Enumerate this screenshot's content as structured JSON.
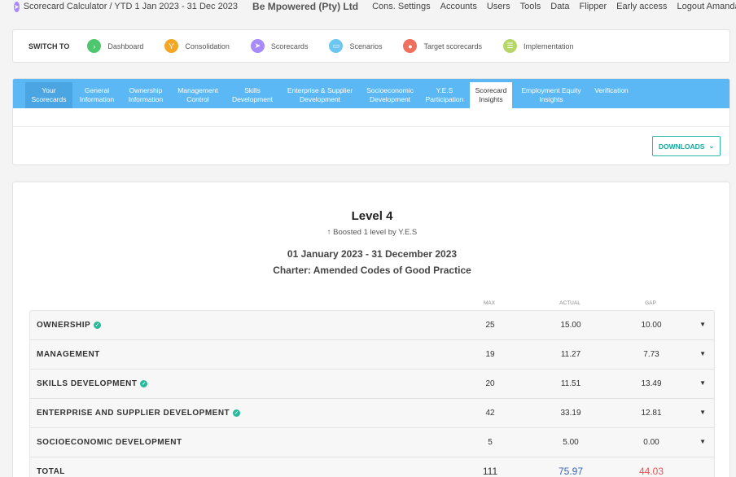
{
  "topbar": {
    "app_title": "Scorecard Calculator",
    "period": "/ YTD 1 Jan 2023 - 31 Dec 2023",
    "company": "Be Mpowered (Pty) Ltd",
    "nav": [
      "Cons. Settings",
      "Accounts",
      "Users",
      "Tools",
      "Data",
      "Flipper",
      "Early access",
      "Logout Amanda"
    ]
  },
  "switchbar": {
    "label": "SWITCH TO",
    "items": [
      {
        "label": "Dashboard",
        "icon": "chevron-right-icon",
        "color": "#4cc76e"
      },
      {
        "label": "Consolidation",
        "icon": "merge-icon",
        "color": "#f5a623"
      },
      {
        "label": "Scorecards",
        "icon": "paper-plane-icon",
        "color": "#a78bfa"
      },
      {
        "label": "Scenarios",
        "icon": "monitor-icon",
        "color": "#6cc6f0"
      },
      {
        "label": "Target scorecards",
        "icon": "map-pin-icon",
        "color": "#ef6f5e"
      },
      {
        "label": "Implementation",
        "icon": "list-icon",
        "color": "#b6d66a"
      }
    ]
  },
  "tabs": [
    {
      "l1": "Your",
      "l2": "Scorecards"
    },
    {
      "l1": "General",
      "l2": "Information"
    },
    {
      "l1": "Ownership",
      "l2": "Information"
    },
    {
      "l1": "Management",
      "l2": "Control"
    },
    {
      "l1": "Skills",
      "l2": "Development"
    },
    {
      "l1": "Enterprise & Supplier",
      "l2": "Development"
    },
    {
      "l1": "Socioeconomic",
      "l2": "Development"
    },
    {
      "l1": "Y.E.S",
      "l2": "Participation"
    },
    {
      "l1": "Scorecard",
      "l2": "Insights"
    },
    {
      "l1": "Employment Equity",
      "l2": "Insights"
    },
    {
      "l1": "Verification",
      "l2": ""
    }
  ],
  "downloads_label": "DOWNLOADS",
  "summary": {
    "level": "Level 4",
    "boost": "Boosted 1 level by Y.E.S",
    "date_range": "01 January 2023 - 31 December 2023",
    "charter": "Charter: Amended Codes of Good Practice"
  },
  "columns": {
    "max": "MAX",
    "actual": "ACTUAL",
    "gap": "GAP"
  },
  "rows": [
    {
      "name": "OWNERSHIP",
      "verified": true,
      "max": "25",
      "actual": "15.00",
      "gap": "10.00"
    },
    {
      "name": "MANAGEMENT",
      "verified": false,
      "max": "19",
      "actual": "11.27",
      "gap": "7.73"
    },
    {
      "name": "SKILLS DEVELOPMENT",
      "verified": true,
      "max": "20",
      "actual": "11.51",
      "gap": "13.49"
    },
    {
      "name": "ENTERPRISE AND SUPPLIER DEVELOPMENT",
      "verified": true,
      "max": "42",
      "actual": "33.19",
      "gap": "12.81"
    },
    {
      "name": "SOCIOECONOMIC DEVELOPMENT",
      "verified": false,
      "max": "5",
      "actual": "5.00",
      "gap": "0.00"
    }
  ],
  "total": {
    "label": "TOTAL",
    "max": "111",
    "actual": "75.97",
    "gap": "44.03",
    "actual_color": "#3a62b8",
    "gap_color": "#e05555"
  }
}
